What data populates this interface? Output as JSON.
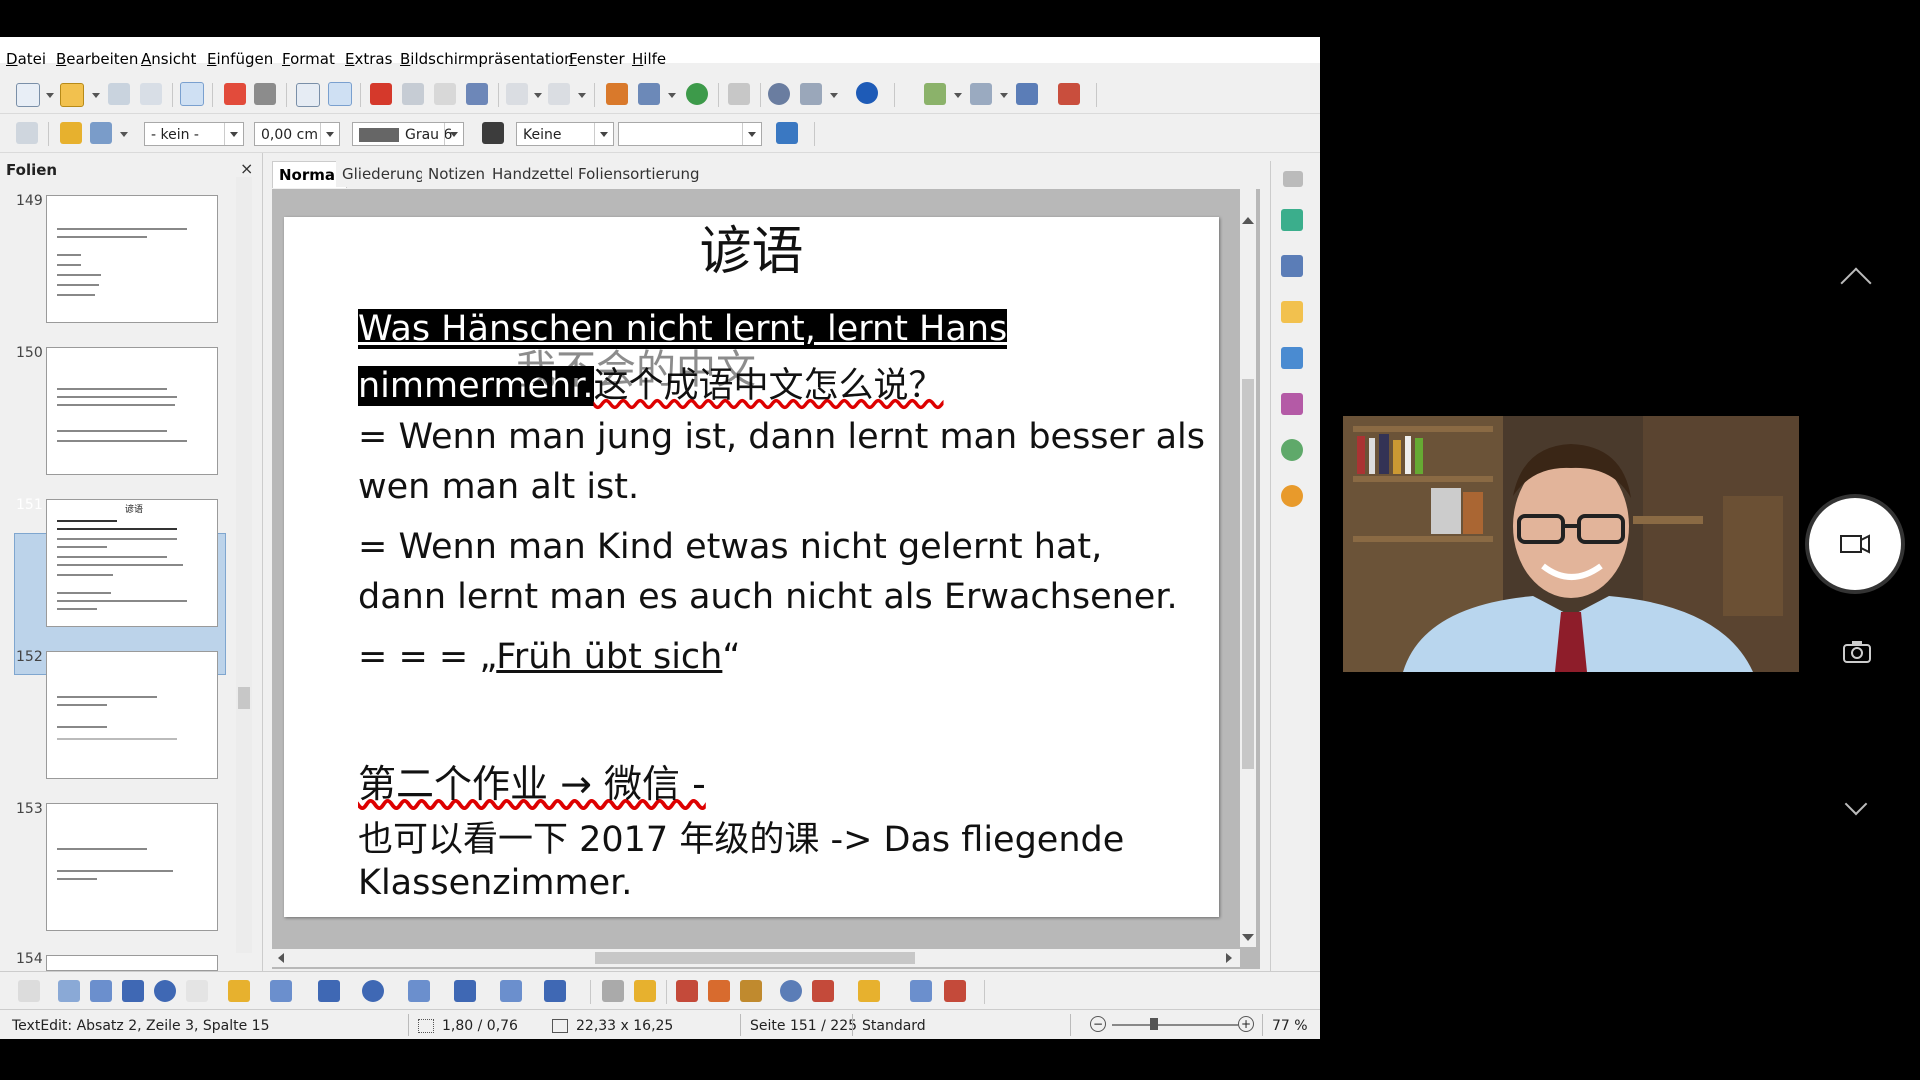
{
  "menubar": {
    "items": [
      "Datei",
      "Bearbeiten",
      "Ansicht",
      "Einfügen",
      "Format",
      "Extras",
      "Bildschirmpräsentation",
      "Fenster",
      "Hilfe"
    ]
  },
  "toolbar2": {
    "line_style": "- kein -",
    "line_width": "0,00 cm",
    "color": "Grau 6",
    "area_style": "Keine",
    "area_value": ""
  },
  "slidepane": {
    "title": "Folien",
    "close_glyph": "×",
    "slides": [
      {
        "number": "149",
        "selected": false
      },
      {
        "number": "150",
        "selected": false
      },
      {
        "number": "151",
        "selected": true
      },
      {
        "number": "152",
        "selected": false
      },
      {
        "number": "153",
        "selected": false
      },
      {
        "number": "154",
        "selected": false
      }
    ],
    "slide151_title": "谚语"
  },
  "view_tabs": [
    "Normal",
    "Gliederung",
    "Notizen",
    "Handzettel",
    "Foliensortierung"
  ],
  "slide": {
    "title": "谚语",
    "line1": "Was Hänschen nicht lernt, lernt Hans",
    "line2a": "nimmermehr.",
    "line2b": "这个成语中文怎么说？",
    "line2_ghost": "我不会的中文",
    "line3": "= Wenn man jung ist, dann lernt man besser als",
    "line4": "wen man alt ist.",
    "line5": "= Wenn man Kind etwas nicht gelernt hat,",
    "line6": "dann lernt man es auch nicht als Erwachsener.",
    "line7a": "= = = „",
    "line7b": "Früh übt sich",
    "line7c": "“",
    "line8": "第二个作业 → 微信  -",
    "line9": "也可以看一下 2017 年级的课 -> Das fliegende",
    "line10": "Klassenzimmer."
  },
  "status": {
    "textedit": "TextEdit: Absatz 2, Zeile 3, Spalte 15",
    "position": "1,80 / 0,76",
    "size": "22,33 x 16,25",
    "page": "Seite 151 / 225",
    "layout": "Standard",
    "zoom": "77 %"
  },
  "colors": {
    "accent": "#bcd3ea",
    "spell_error": "#dd0000",
    "highlight": "#000000"
  }
}
